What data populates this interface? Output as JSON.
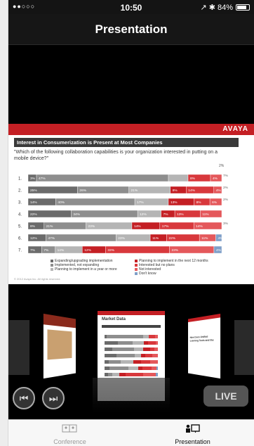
{
  "status_bar": {
    "signal": "●●○○○",
    "time": "10:50",
    "right": "↗ ✱ 84%",
    "battery_percent": 84
  },
  "nav": {
    "title": "Presentation"
  },
  "slide": {
    "logo": "AVAYA",
    "title": "Interest in Consumerization is Present at Most Companies",
    "question": "\"Which of the following collaboration capabilities is your organization interested in putting on a mobile device?\"",
    "footer": "© 2012 Avaya Inc. All rights reserved."
  },
  "chart_data": {
    "type": "bar",
    "orientation": "horizontal",
    "stacked": true,
    "categories": [
      "1.",
      "2.",
      "3.",
      "4.",
      "5.",
      "6.",
      "7."
    ],
    "series": [
      {
        "name": "Expanding/upgrading implementation",
        "color": "#6b6b6b",
        "values": [
          3,
          25,
          14,
          22,
          8,
          12,
          7
        ]
      },
      {
        "name": "Implemented, not expanding",
        "color": "#8e8e8e",
        "values": [
          47,
          26,
          40,
          34,
          21,
          47,
          7
        ]
      },
      {
        "name": "Planning to implement in a year or more",
        "color": "#b5b5b5",
        "values": [
          7,
          21,
          17,
          12,
          23,
          23,
          14
        ]
      },
      {
        "name": "Planning to implement in the next 12 months",
        "color": "#c41f24",
        "values": [
          null,
          8,
          13,
          7,
          14,
          11,
          12
        ]
      },
      {
        "name": "Interested but no plans",
        "color": "#d8383c",
        "values": [
          8,
          14,
          8,
          13,
          17,
          22,
          33
        ]
      },
      {
        "name": "Not interested",
        "color": "#e4585b",
        "values": [
          4,
          4,
          6,
          11,
          14,
          11,
          23
        ]
      },
      {
        "name": "Don't know",
        "color": "#7f9fc8",
        "values": [
          null,
          null,
          null,
          null,
          null,
          4,
          4
        ]
      }
    ],
    "labels": [
      [
        "3%",
        "47%",
        "",
        "7%",
        "8%",
        "4%",
        "7%"
      ],
      [
        "25%",
        "26%",
        "21%",
        "8%",
        "14%",
        "4%",
        "2%"
      ],
      [
        "14%",
        "40%",
        "17%",
        "13%",
        "8%",
        "6%",
        "2%"
      ],
      [
        "22%",
        "34%",
        "12%",
        "7%",
        "13%",
        "11%",
        ""
      ],
      [
        "8%",
        "21%",
        "23%",
        "14%",
        "17%",
        "14%",
        "3%"
      ],
      [
        "12%",
        "47%",
        "23%",
        "11%",
        "22%",
        "11%",
        "4%"
      ],
      [
        "7%",
        "7%",
        "14%",
        "12%",
        "33%",
        "23%",
        "4%"
      ]
    ],
    "top_label": "2%"
  },
  "legend": {
    "col1": [
      "Expanding/upgrading implementation",
      "Implemented, not expanding",
      "Planning to implement in a year or more"
    ],
    "col2": [
      "Planning to implement in the next 12 months",
      "Interested but no plans",
      "Not interested",
      "Don't know"
    ]
  },
  "carousel": {
    "center_title": "Market Data",
    "right_title": "How Does Unified Learning Tools and the",
    "prev_icon": "rewind-icon",
    "next_icon": "fast-forward-icon",
    "live_label": "LIVE"
  },
  "tabs": [
    {
      "label": "Conference",
      "icon": "conference-icon",
      "active": false
    },
    {
      "label": "Presentation",
      "icon": "presentation-icon",
      "active": true
    }
  ]
}
